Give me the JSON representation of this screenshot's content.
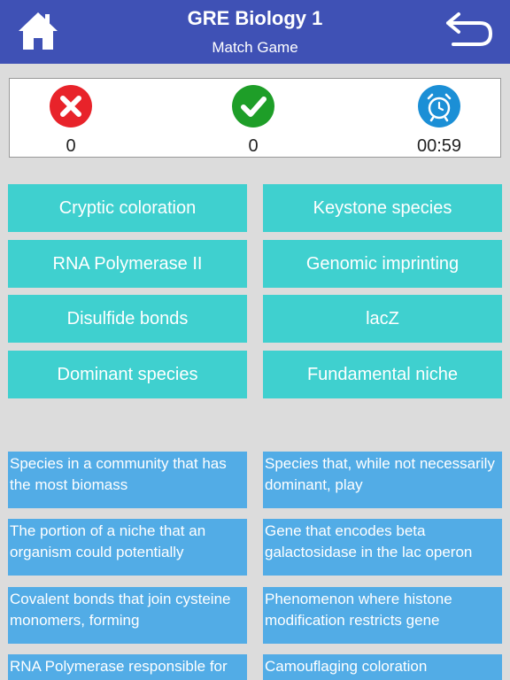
{
  "header": {
    "title": "GRE Biology 1",
    "subtitle": "Match Game",
    "home_icon": "home-icon",
    "back_icon": "back-arrow-icon"
  },
  "score": {
    "wrong": "0",
    "correct": "0",
    "timer": "00:59",
    "wrong_color": "#e8232a",
    "correct_color": "#1e9e28",
    "timer_color": "#1b8fd6"
  },
  "colors": {
    "header_bg": "#3f51b5",
    "term_bg": "#3fd0cf",
    "definition_bg": "#52ace6",
    "page_bg": "#dcdcdc"
  },
  "terms": [
    "Cryptic coloration",
    "Keystone species",
    "RNA Polymerase II",
    "Genomic imprinting",
    "Disulfide bonds",
    "lacZ",
    "Dominant species",
    "Fundamental niche"
  ],
  "definitions": [
    "Species in a community that has the most biomass",
    "Species that, while not necessarily dominant, play",
    "The portion of a niche that an organism could potentially",
    "Gene that encodes beta galactosidase in the lac operon",
    "Covalent bonds that join cysteine monomers, forming",
    "Phenomenon where histone modification restricts gene",
    "RNA Polymerase responsible for",
    "Camouflaging coloration"
  ]
}
